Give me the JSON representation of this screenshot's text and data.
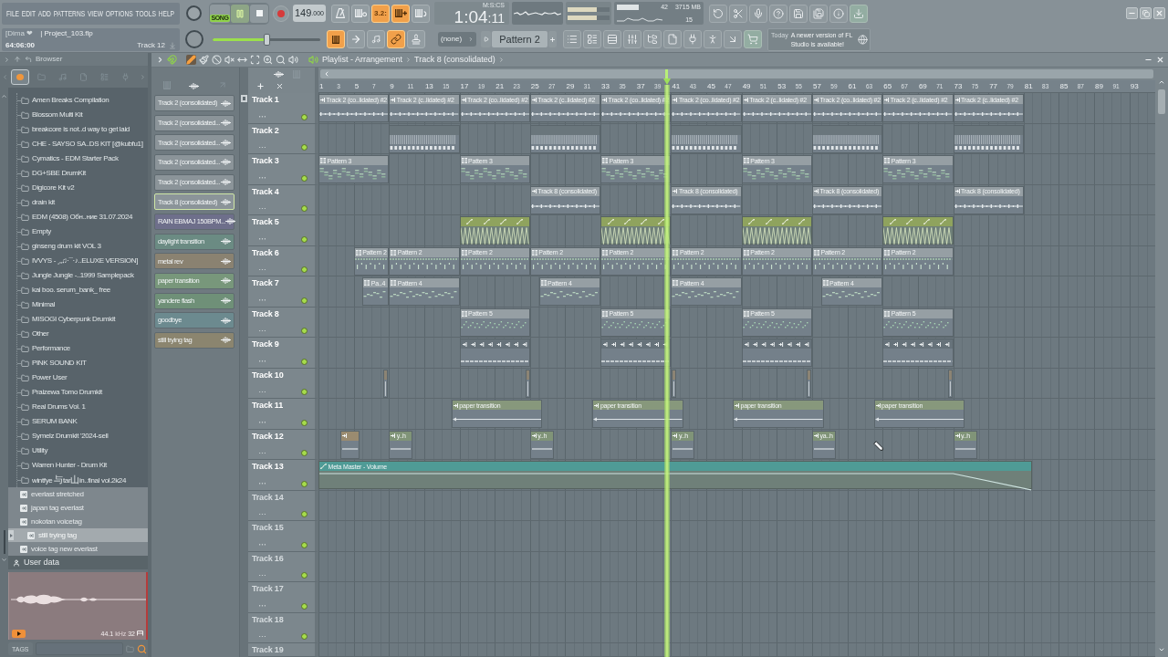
{
  "menu": [
    "FILE",
    "EDIT",
    "ADD",
    "PATTERNS",
    "VIEW",
    "OPTIONS",
    "TOOLS",
    "HELP"
  ],
  "project": {
    "user": "[Dima ❤",
    "file": "| Project_103.flp",
    "position": "64:06:00",
    "hint": "Track 12"
  },
  "transport": {
    "mode": {
      "label": "SONG",
      "on": true
    },
    "playing": true,
    "tempo": "149.000"
  },
  "master_volume": {
    "level": 0.5
  },
  "record_toggles": [
    {
      "on": false
    },
    {
      "on": false
    },
    {
      "label": "3.2:",
      "on": true
    },
    {
      "on": true
    },
    {
      "on": false
    }
  ],
  "edit_toggles": [
    {
      "on": true
    },
    {
      "on": false
    },
    {
      "on": false
    },
    {
      "on": true
    },
    {
      "on": false
    }
  ],
  "time_display": {
    "unit": "M:S:CS",
    "value": "1:04:11"
  },
  "output_meter": [
    {
      "level": 0.7
    },
    {
      "level": 0.7
    }
  ],
  "performance": {
    "cpu": "42",
    "memory": "3715 MB",
    "polyphony": "15"
  },
  "pattern_bar": {
    "mixer_track": "(none)",
    "pattern": "Pattern 2"
  },
  "news": {
    "date": "Today",
    "message": "A newer version of FL Studio is available!"
  },
  "browser": {
    "title": "Browser",
    "tabs": [
      {
        "selected": true
      },
      {
        "selected": false
      },
      {
        "selected": false
      },
      {
        "selected": false
      },
      {
        "selected": false
      },
      {
        "selected": false
      }
    ],
    "folders": [
      "Amen Breaks Compilation",
      "Blossom Multi Kit",
      "breakcore is not..d way to get laid",
      "CHE - SAYSO SA..DS KIT [@kubfu1]",
      "Cymatics - EDM Starter Pack",
      "DG+SBE DrumKit",
      "Digicore Kit v2",
      "drain kit",
      "EDM (4508) Обн..ние 31.07.2024",
      "Empty",
      "ginseng drum kit VOL 3",
      "IVVYS - ¸„♫·¯·♪..ELUXE VERSION]",
      "Jungle Jungle -..1999 Samplepack",
      "kai boo. serum_bank_ free",
      "Minimal",
      "MISOGI Cyberpunk Drumkit",
      "Other",
      "Performance",
      "PINK SOUND KIT",
      "Power User",
      "Praizewa Tomo Drumkit",
      "Real Drums Vol. 1",
      "SERUM BANK",
      "Symelz Drumkit '2024-sell",
      "Utility",
      "Warren Hunter - Drum Kit",
      "wintfye 与tar山in..final vol.2k24"
    ],
    "files": [
      {
        "label": "everlast stretched",
        "selected": false
      },
      {
        "label": "japan tag everlast",
        "selected": false
      },
      {
        "label": "nokotan voicetag",
        "selected": false
      },
      {
        "label": "still trying tag",
        "selected": true
      },
      {
        "label": "voice tag new everlast",
        "selected": false
      }
    ],
    "user_data": "User data",
    "preview": {
      "rate": "44.1",
      "unit": "kHz",
      "bits": "32"
    },
    "tags_label": "TAGS"
  },
  "playlist": {
    "title": "Playlist - Arrangement",
    "breadcrumb": "Track 8 (consolidated)",
    "tools": [
      {
        "selected": true
      },
      {
        "selected": false
      },
      {
        "selected": false
      },
      {
        "selected": false
      },
      {
        "selected": false
      },
      {
        "selected": false
      },
      {
        "selected": false
      },
      {
        "selected": false
      },
      {
        "selected": false
      }
    ],
    "picker": [
      {
        "label": "Track 2 (consolidated)",
        "selected": false,
        "color": "#8b9499"
      },
      {
        "label": "Track 2 (consolidated...",
        "selected": false,
        "color": "#8b9499"
      },
      {
        "label": "Track 2 (consolidated...",
        "selected": false,
        "color": "#8b9499"
      },
      {
        "label": "Track 2 (consolidated...",
        "selected": false,
        "color": "#8b9499"
      },
      {
        "label": "Track 2 (consolidated...",
        "selected": false,
        "color": "#8b9499"
      },
      {
        "label": "Track 8 (consolidated)",
        "selected": true,
        "color": "#8b9499"
      },
      {
        "label": "RAIN EBMAJ 150BPM...",
        "selected": false,
        "color": "#6e6f8b"
      },
      {
        "label": "daylight transition",
        "selected": false,
        "color": "#6b8b83"
      },
      {
        "label": "metal rev",
        "selected": false,
        "color": "#8a8271"
      },
      {
        "label": "paper transition",
        "selected": false,
        "color": "#78977b"
      },
      {
        "label": "yandere flash",
        "selected": false,
        "color": "#6f9078"
      },
      {
        "label": "goodbye",
        "selected": false,
        "color": "#6c8a8f"
      },
      {
        "label": "still trying tag",
        "selected": false,
        "color": "#8b856f"
      }
    ],
    "ruler": [
      "1",
      "3",
      "5",
      "7",
      "9",
      "11",
      "13",
      "15",
      "17",
      "19",
      "21",
      "23",
      "25",
      "27",
      "29",
      "31",
      "33",
      "35",
      "37",
      "39",
      "41",
      "43",
      "45",
      "47",
      "49",
      "51",
      "53",
      "55",
      "57",
      "59",
      "61",
      "63",
      "65",
      "67",
      "69",
      "71",
      "73",
      "75",
      "77",
      "79",
      "81",
      "83",
      "85",
      "87",
      "89",
      "91",
      "93"
    ],
    "tracks": [
      {
        "name": "Track 1",
        "enabled": true,
        "dimmed": false,
        "clips": [
          {
            "kind": "audio",
            "label": "Track 2 (co..lidated) #2",
            "color": "#969fa4"
          },
          {
            "kind": "audio",
            "label": "Track 2 (c..lidated) #2",
            "color": "#969fa4"
          },
          {
            "kind": "audio",
            "label": "Track 2 (co..lidated) #2",
            "color": "#969fa4"
          },
          {
            "kind": "audio",
            "label": "Track 2 (c..lidated) #2",
            "color": "#969fa4"
          },
          {
            "kind": "audio",
            "label": "Track 2 (co..lidated) #2",
            "color": "#969fa4"
          },
          {
            "kind": "audio",
            "label": "Track 2 (co..lidated) #2",
            "color": "#969fa4"
          },
          {
            "kind": "audio",
            "label": "Track 2 (c..lidated) #2",
            "color": "#969fa4"
          },
          {
            "kind": "audio",
            "label": "Track 2 (co..lidated) #2",
            "color": "#969fa4"
          },
          {
            "kind": "audio",
            "label": "Track 2 (c..lidated) #2",
            "color": "#969fa4"
          },
          {
            "kind": "audio",
            "label": "Track 2 (c..lidated) #2",
            "color": "#969fa4"
          }
        ]
      },
      {
        "name": "Track 2",
        "enabled": true,
        "dimmed": false,
        "clips": [
          {
            "kind": "audio",
            "color": "#6a767c"
          },
          {
            "kind": "audio",
            "color": "#6a767c"
          },
          {
            "kind": "audio",
            "color": "#6a767c"
          },
          {
            "kind": "audio",
            "color": "#6a767c"
          },
          {
            "kind": "audio",
            "color": "#6a767c"
          }
        ]
      },
      {
        "name": "Track 3",
        "enabled": true,
        "dimmed": false,
        "clips": [
          {
            "kind": "pattern",
            "label": "Pattern 3",
            "color": "#969fa4"
          },
          {
            "kind": "pattern",
            "label": "Pattern 3",
            "color": "#969fa4"
          },
          {
            "kind": "pattern",
            "label": "Pattern 3",
            "color": "#969fa4"
          },
          {
            "kind": "pattern",
            "label": "Pattern 3",
            "color": "#969fa4"
          },
          {
            "kind": "pattern",
            "label": "Pattern 3",
            "color": "#969fa4"
          }
        ]
      },
      {
        "name": "Track 4",
        "enabled": true,
        "dimmed": false,
        "clips": [
          {
            "kind": "audio",
            "label": "Track 8 (consolidated)",
            "color": "#969fa4"
          },
          {
            "kind": "audio",
            "label": "Track 8 (consolidated)",
            "color": "#969fa4"
          },
          {
            "kind": "audio",
            "label": "Track 8 (consolidated)",
            "color": "#969fa4"
          },
          {
            "kind": "audio",
            "label": "Track 8 (consolidated)",
            "color": "#969fa4"
          }
        ]
      },
      {
        "name": "Track 5",
        "enabled": true,
        "dimmed": false,
        "clips": [
          {
            "kind": "automation",
            "color": "#8fa35e"
          },
          {
            "kind": "automation",
            "color": "#8fa35e"
          },
          {
            "kind": "automation",
            "color": "#8fa35e"
          },
          {
            "kind": "automation",
            "color": "#8fa35e"
          }
        ]
      },
      {
        "name": "Track 6",
        "enabled": true,
        "dimmed": false,
        "clips": [
          {
            "kind": "pattern",
            "label": "Pattern 2",
            "color": "#969fa4"
          },
          {
            "kind": "pattern",
            "label": "Pattern 2",
            "color": "#969fa4"
          },
          {
            "kind": "pattern",
            "label": "Pattern 2",
            "color": "#969fa4"
          },
          {
            "kind": "pattern",
            "label": "Pattern 2",
            "color": "#969fa4"
          },
          {
            "kind": "pattern",
            "label": "Pattern 2",
            "color": "#969fa4"
          },
          {
            "kind": "pattern",
            "label": "Pattern 2",
            "color": "#969fa4"
          },
          {
            "kind": "pattern",
            "label": "Pattern 2",
            "color": "#969fa4"
          },
          {
            "kind": "pattern",
            "label": "Pattern 2",
            "color": "#969fa4"
          },
          {
            "kind": "pattern",
            "label": "Pattern 2",
            "color": "#969fa4"
          }
        ]
      },
      {
        "name": "Track 7",
        "enabled": true,
        "dimmed": false,
        "clips": [
          {
            "kind": "pattern",
            "label": "Pa..4",
            "color": "#969fa4"
          },
          {
            "kind": "pattern",
            "label": "Pattern 4",
            "color": "#969fa4"
          },
          {
            "kind": "pattern",
            "label": "Pattern 4",
            "color": "#969fa4"
          },
          {
            "kind": "pattern",
            "label": "Pattern 4",
            "color": "#969fa4"
          },
          {
            "kind": "pattern",
            "label": "Pattern 4",
            "color": "#969fa4"
          }
        ]
      },
      {
        "name": "Track 8",
        "enabled": true,
        "dimmed": false,
        "clips": [
          {
            "kind": "pattern",
            "label": "Pattern 5",
            "color": "#969fa4"
          },
          {
            "kind": "pattern",
            "label": "Pattern 5",
            "color": "#969fa4"
          },
          {
            "kind": "pattern",
            "label": "Pattern 5",
            "color": "#969fa4"
          },
          {
            "kind": "pattern",
            "label": "Pattern 5",
            "color": "#969fa4"
          }
        ]
      },
      {
        "name": "Track 9",
        "enabled": true,
        "dimmed": false,
        "clips": [
          {
            "kind": "audio",
            "color": "#66727a"
          },
          {
            "kind": "audio",
            "color": "#66727a"
          },
          {
            "kind": "audio",
            "color": "#66727a"
          },
          {
            "kind": "audio",
            "color": "#66727a"
          }
        ]
      },
      {
        "name": "Track 10",
        "enabled": true,
        "dimmed": false,
        "clips": [
          {
            "kind": "audio",
            "color": "#8c8474"
          },
          {
            "kind": "audio",
            "color": "#8c8474"
          },
          {
            "kind": "audio",
            "color": "#8c8474"
          },
          {
            "kind": "audio",
            "color": "#8c8474"
          },
          {
            "kind": "audio",
            "color": "#8c8474"
          }
        ]
      },
      {
        "name": "Track 11",
        "enabled": true,
        "dimmed": false,
        "clips": [
          {
            "kind": "audio",
            "label": "paper transition",
            "color": "#87987c"
          },
          {
            "kind": "audio",
            "label": "paper transition",
            "color": "#87987c"
          },
          {
            "kind": "audio",
            "label": "paper transition",
            "color": "#87987c"
          },
          {
            "kind": "audio",
            "label": "paper transition",
            "color": "#87987c"
          }
        ]
      },
      {
        "name": "Track 12",
        "enabled": true,
        "dimmed": false,
        "clips": [
          {
            "kind": "audio",
            "color": "#9a8b70"
          },
          {
            "kind": "audio",
            "label": "y..h",
            "color": "#809478"
          },
          {
            "kind": "audio",
            "label": "y..h",
            "color": "#809478"
          },
          {
            "kind": "audio",
            "label": "y..h",
            "color": "#809478"
          },
          {
            "kind": "audio",
            "label": "ya..h",
            "color": "#809478"
          },
          {
            "kind": "audio",
            "label": "y..h",
            "color": "#809478"
          }
        ]
      },
      {
        "name": "Track 13",
        "enabled": true,
        "dimmed": false,
        "clips": [
          {
            "kind": "automation",
            "label": "Meta Master - Volume",
            "color": "#4f9b96"
          }
        ]
      },
      {
        "name": "Track 14",
        "enabled": true,
        "dimmed": true
      },
      {
        "name": "Track 15",
        "enabled": true,
        "dimmed": true
      },
      {
        "name": "Track 16",
        "enabled": true,
        "dimmed": true
      },
      {
        "name": "Track 17",
        "enabled": true,
        "dimmed": true
      },
      {
        "name": "Track 18",
        "enabled": true,
        "dimmed": true
      },
      {
        "name": "Track 19",
        "dimmed": true
      }
    ]
  }
}
